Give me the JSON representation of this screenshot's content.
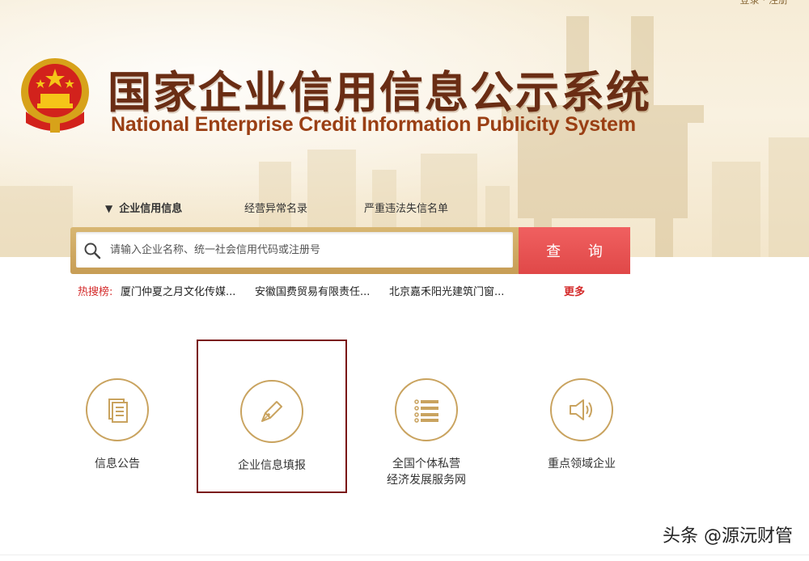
{
  "header": {
    "top_links": "登录 · 注册",
    "title_cn": "国家企业信用信息公示系统",
    "title_en": "National Enterprise Credit Information Publicity System"
  },
  "tabs": [
    {
      "label": "企业信用信息",
      "active": true
    },
    {
      "label": "经营异常名录",
      "active": false
    },
    {
      "label": "严重违法失信名单",
      "active": false
    }
  ],
  "search": {
    "placeholder": "请输入企业名称、统一社会信用代码或注册号",
    "button_label": "查 询"
  },
  "hot_search": {
    "label": "热搜榜:",
    "items": [
      "厦门仲夏之月文化传媒...",
      "安徽国费贸易有限责任...",
      "北京嘉禾阳光建筑门窗..."
    ],
    "more_label": "更多"
  },
  "cards": [
    {
      "label": "信息公告",
      "icon": "document-icon",
      "selected": false
    },
    {
      "label": "企业信息填报",
      "icon": "pen-icon",
      "selected": true
    },
    {
      "label": "全国个体私营\n经济发展服务网",
      "icon": "list-icon",
      "selected": false
    },
    {
      "label": "重点领域企业",
      "icon": "speaker-icon",
      "selected": false
    }
  ],
  "watermark": "头条 @源沅财管",
  "colors": {
    "brand_dark": "#6a2d14",
    "brand_red": "#e04848",
    "gold": "#c9a35f",
    "selected_border": "#7a1616"
  }
}
